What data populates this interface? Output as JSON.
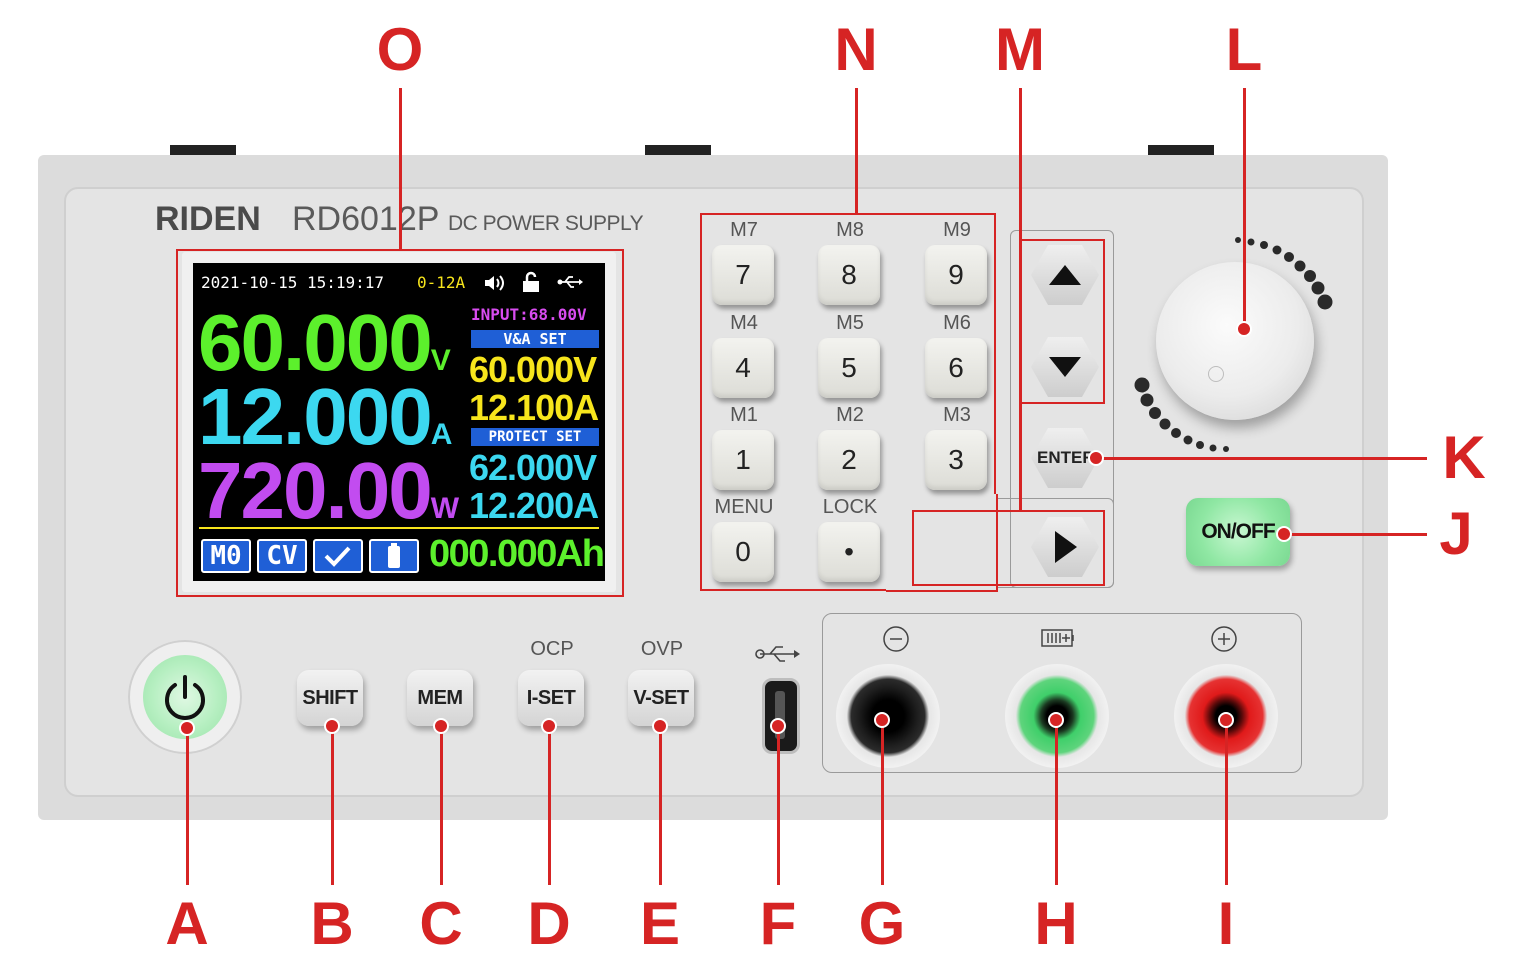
{
  "device": {
    "brand": "RIDEN",
    "model": "RD6012P",
    "subtitle": "DC POWER SUPPLY"
  },
  "display": {
    "datetime": "2021-10-15 15:19:17",
    "range": "0-12A",
    "input": "INPUT:68.00V",
    "voltage": "60.000",
    "voltage_unit": "V",
    "current": "12.000",
    "current_unit": "A",
    "power": "720.00",
    "power_unit": "W",
    "va_set_label": "V&A SET",
    "set_voltage": "60.000V",
    "set_current": "12.100A",
    "protect_set_label": "PROTECT SET",
    "protect_voltage": "62.000V",
    "protect_current": "12.200A",
    "memory_tag": "M0",
    "mode_tag": "CV",
    "capacity": "000.000Ah",
    "colors": {
      "voltage": "#5cf02c",
      "current": "#3cd8f0",
      "power": "#c24cf0",
      "set": "#f7e51c",
      "protect": "#3cd8f0",
      "input": "#d84cf0",
      "capacity": "#5cf02c"
    }
  },
  "keypad": [
    {
      "mem": "M7",
      "digit": "7"
    },
    {
      "mem": "M8",
      "digit": "8"
    },
    {
      "mem": "M9",
      "digit": "9"
    },
    {
      "mem": "M4",
      "digit": "4"
    },
    {
      "mem": "M5",
      "digit": "5"
    },
    {
      "mem": "M6",
      "digit": "6"
    },
    {
      "mem": "M1",
      "digit": "1"
    },
    {
      "mem": "M2",
      "digit": "2"
    },
    {
      "mem": "M3",
      "digit": "3"
    },
    {
      "mem": "MENU",
      "digit": "0"
    },
    {
      "mem": "LOCK",
      "digit": "•"
    }
  ],
  "buttons": {
    "shift": "SHIFT",
    "mem": "MEM",
    "iset": "I-SET",
    "iset_alt": "OCP",
    "vset": "V-SET",
    "vset_alt": "OVP",
    "enter": "ENTER",
    "onoff": "ON/OFF"
  },
  "callouts": {
    "A": "A",
    "B": "B",
    "C": "C",
    "D": "D",
    "E": "E",
    "F": "F",
    "G": "G",
    "H": "H",
    "I": "I",
    "J": "J",
    "K": "K",
    "L": "L",
    "M": "M",
    "N": "N",
    "O": "O"
  },
  "icons": [
    "power-icon",
    "speaker-icon",
    "unlock-icon",
    "usb-icon",
    "check-icon",
    "battery-icon",
    "minus-circle-icon",
    "plus-circle-icon",
    "arrow-up-icon",
    "arrow-down-icon",
    "arrow-left-icon",
    "arrow-right-icon"
  ]
}
